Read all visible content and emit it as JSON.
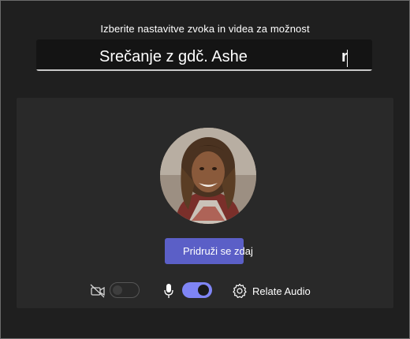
{
  "header": {
    "subtitle": "Izberite nastavitve zvoka in videa za možnost",
    "meeting_title": "Srečanje z gdč. Ashe",
    "title_trailing_char": "r"
  },
  "preview": {
    "join_button_label": "Pridruži se zdaj"
  },
  "controls": {
    "camera_enabled": false,
    "microphone_enabled": true,
    "audio_settings_label": "Relate Audio"
  },
  "colors": {
    "accent": "#5b5fc7",
    "toggle_on": "#7f85f5",
    "background": "#1f1f1f",
    "panel": "#292929"
  }
}
